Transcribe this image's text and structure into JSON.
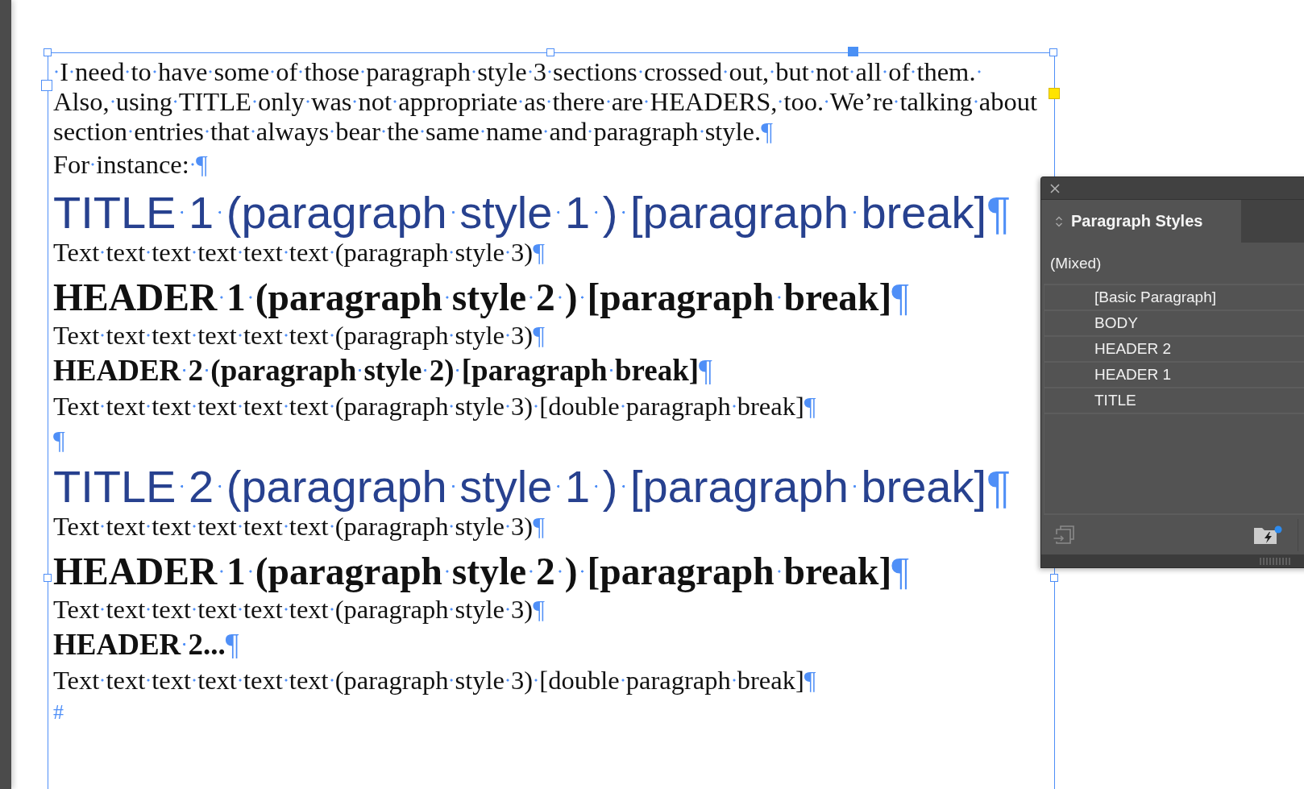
{
  "text_frame": {
    "paragraphs": [
      {
        "kind": "body",
        "lines": [
          " I need to have some of those paragraph style 3 sections crossed out, but not all of them. ",
          "Also, using TITLE only was not appropriate as there are HEADERS, too. We’re talking about",
          "section entries that always bear the same name and paragraph style."
        ],
        "mark": "¶"
      },
      {
        "kind": "body",
        "lines": [
          "For instance: "
        ],
        "mark": "¶"
      },
      {
        "kind": "title",
        "lines": [
          "TITLE 1 (paragraph style 1 ) [paragraph break]"
        ],
        "mark": "¶"
      },
      {
        "kind": "body",
        "lines": [
          "Text text text text text text (paragraph style 3)"
        ],
        "mark": "¶"
      },
      {
        "kind": "heading1",
        "lines": [
          "HEADER 1 (paragraph style 2 ) [paragraph break]"
        ],
        "mark": "¶"
      },
      {
        "kind": "body",
        "lines": [
          "Text text text text text text (paragraph style 3)"
        ],
        "mark": "¶"
      },
      {
        "kind": "heading2",
        "lines": [
          "HEADER 2 (paragraph style 2) [paragraph break]"
        ],
        "mark": "¶"
      },
      {
        "kind": "body",
        "lines": [
          "Text text text text text text (paragraph style 3) [double paragraph break]"
        ],
        "mark": "¶"
      },
      {
        "kind": "empty",
        "mark": "¶"
      },
      {
        "kind": "title",
        "lines": [
          "TITLE 2 (paragraph style 1 ) [paragraph break]"
        ],
        "mark": "¶"
      },
      {
        "kind": "body",
        "lines": [
          "Text text text text text text (paragraph style 3)"
        ],
        "mark": "¶"
      },
      {
        "kind": "heading1",
        "lines": [
          "HEADER 1 (paragraph style 2 ) [paragraph break]"
        ],
        "mark": "¶"
      },
      {
        "kind": "body",
        "lines": [
          "Text text text text text text (paragraph style 3)"
        ],
        "mark": "¶"
      },
      {
        "kind": "heading2",
        "lines": [
          "HEADER 2..."
        ],
        "mark": "¶"
      },
      {
        "kind": "body",
        "lines": [
          "Text text text text text text (paragraph style 3) [double paragraph break]"
        ],
        "mark": "¶"
      }
    ],
    "end_mark": "#"
  },
  "panel": {
    "tabs": [
      {
        "label": "Paragraph Styles",
        "selected": true
      }
    ],
    "current_style": "(Mixed)",
    "styles": [
      {
        "name": "[Basic Paragraph]",
        "selected": false
      },
      {
        "name": "BODY",
        "selected": false
      },
      {
        "name": "HEADER 2",
        "selected": false
      },
      {
        "name": "HEADER 1",
        "selected": false
      },
      {
        "name": "TITLE",
        "selected": false
      }
    ]
  }
}
